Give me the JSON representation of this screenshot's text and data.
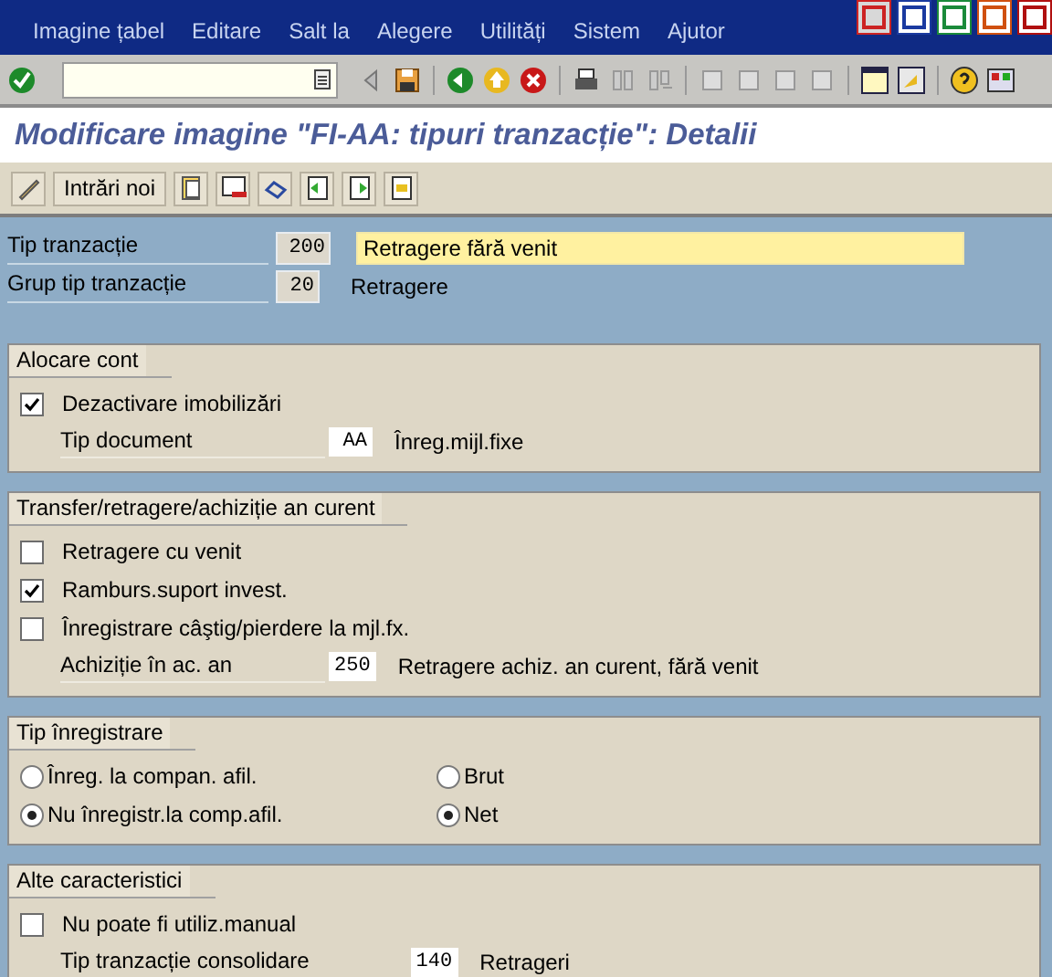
{
  "menu": [
    {
      "label": "Imagine țabel"
    },
    {
      "label": "Editare"
    },
    {
      "label": "Salt la"
    },
    {
      "label": "Alegere"
    },
    {
      "label": "Utilități"
    },
    {
      "label": "Sistem"
    },
    {
      "label": "Ajutor"
    }
  ],
  "title": "Modificare imagine \"FI-AA: tipuri tranzacție\": Detalii",
  "app_toolbar": {
    "button": "Intrări noi"
  },
  "header_fields": [
    {
      "label": "Tip tranzacție",
      "code": "200",
      "description": "Retragere fără venit",
      "kind": "input"
    },
    {
      "label": "Grup tip tranzacție",
      "code": "20",
      "description": "Retragere",
      "kind": "text"
    }
  ],
  "sections": [
    {
      "title": "Alocare cont",
      "rows": [
        {
          "kind": "checkbox",
          "label": "Dezactivare imobilizări",
          "checked": true
        },
        {
          "kind": "field",
          "label": "Tip document",
          "value": "AA",
          "description": "Înreg.mijl.fixe"
        }
      ]
    },
    {
      "title": "Transfer/retragere/achiziție an curent",
      "rows": [
        {
          "kind": "checkbox",
          "label": "Retragere cu venit",
          "checked": false
        },
        {
          "kind": "checkbox",
          "label": "Ramburs.suport invest.",
          "checked": true
        },
        {
          "kind": "checkbox",
          "label": "Înregistrare câştig/pierdere la mjl.fx.",
          "checked": false
        },
        {
          "kind": "field",
          "label": "Achiziție în ac. an",
          "value": "250",
          "description": "Retragere achiz. an curent, fără venit"
        }
      ]
    },
    {
      "title": "Tip înregistrare",
      "rows": [
        {
          "kind": "radios",
          "items": [
            {
              "label": "Înreg. la compan. afil.",
              "selected": false
            },
            {
              "label": "Brut",
              "selected": false
            }
          ]
        },
        {
          "kind": "radios",
          "items": [
            {
              "label": "Nu înregistr.la comp.afil.",
              "selected": true
            },
            {
              "label": "Net",
              "selected": true
            }
          ]
        }
      ]
    },
    {
      "title": "Alte caracteristici",
      "rows": [
        {
          "kind": "checkbox",
          "label": "Nu poate fi utiliz.manual",
          "checked": false
        },
        {
          "kind": "field",
          "label": "Tip tranzacție consolidare",
          "value": "140",
          "description": "Retrageri"
        }
      ]
    }
  ]
}
